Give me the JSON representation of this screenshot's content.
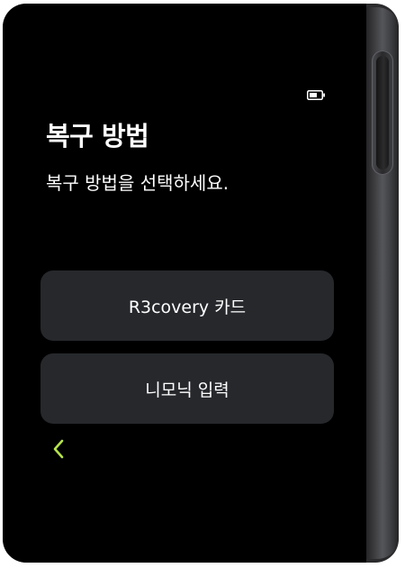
{
  "screen": {
    "title": "복구 방법",
    "subtitle": "복구 방법을 선택하세요.",
    "options": [
      {
        "label": "R3covery 카드"
      },
      {
        "label": "니모닉 입력"
      }
    ]
  },
  "status": {
    "battery_icon": "battery-icon"
  },
  "navigation": {
    "back_icon": "chevron-left-icon"
  },
  "colors": {
    "screen_bg": "#000000",
    "button_bg": "#26282c",
    "text": "#ffffff",
    "accent": "#b6e34b",
    "device_frame": "#2b2b2d"
  }
}
